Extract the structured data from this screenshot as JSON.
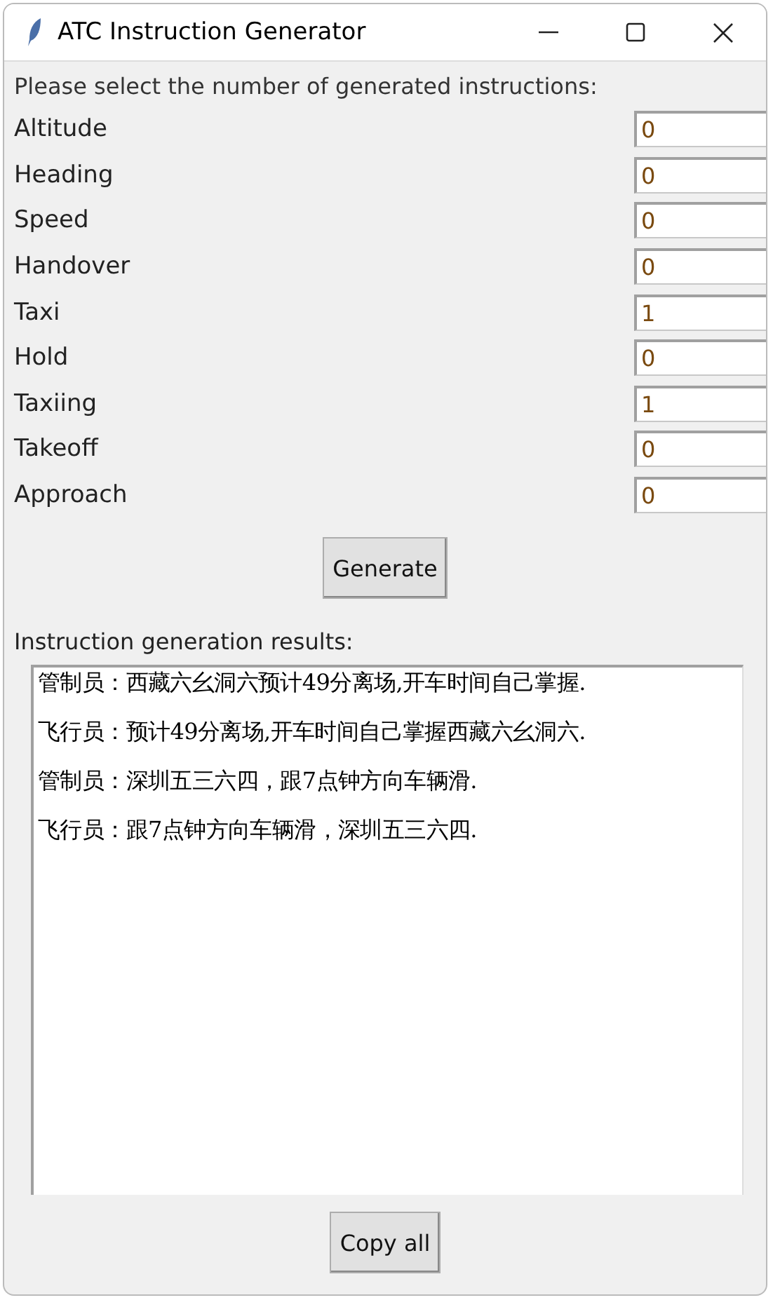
{
  "window": {
    "title": "ATC Instruction Generator"
  },
  "prompt": "Please select the number of generated instructions:",
  "counts": [
    {
      "label": "Altitude",
      "value": "0"
    },
    {
      "label": "Heading",
      "value": "0"
    },
    {
      "label": "Speed",
      "value": "0"
    },
    {
      "label": "Handover",
      "value": "0"
    },
    {
      "label": "Taxi",
      "value": "1"
    },
    {
      "label": "Hold",
      "value": "0"
    },
    {
      "label": "Taxiing",
      "value": "1"
    },
    {
      "label": "Takeoff",
      "value": "0"
    },
    {
      "label": "Approach",
      "value": "0"
    }
  ],
  "generate_button": "Generate",
  "results_label": "Instruction generation results:",
  "results": [
    "管制员：西藏六幺洞六预计49分离场,开车时间自己掌握.",
    "飞行员：预计49分离场,开车时间自己掌握西藏六幺洞六.",
    "管制员：深圳五三六四，跟7点钟方向车辆滑.",
    "飞行员：跟7点钟方向车辆滑，深圳五三六四."
  ],
  "copy_button": "Copy all"
}
